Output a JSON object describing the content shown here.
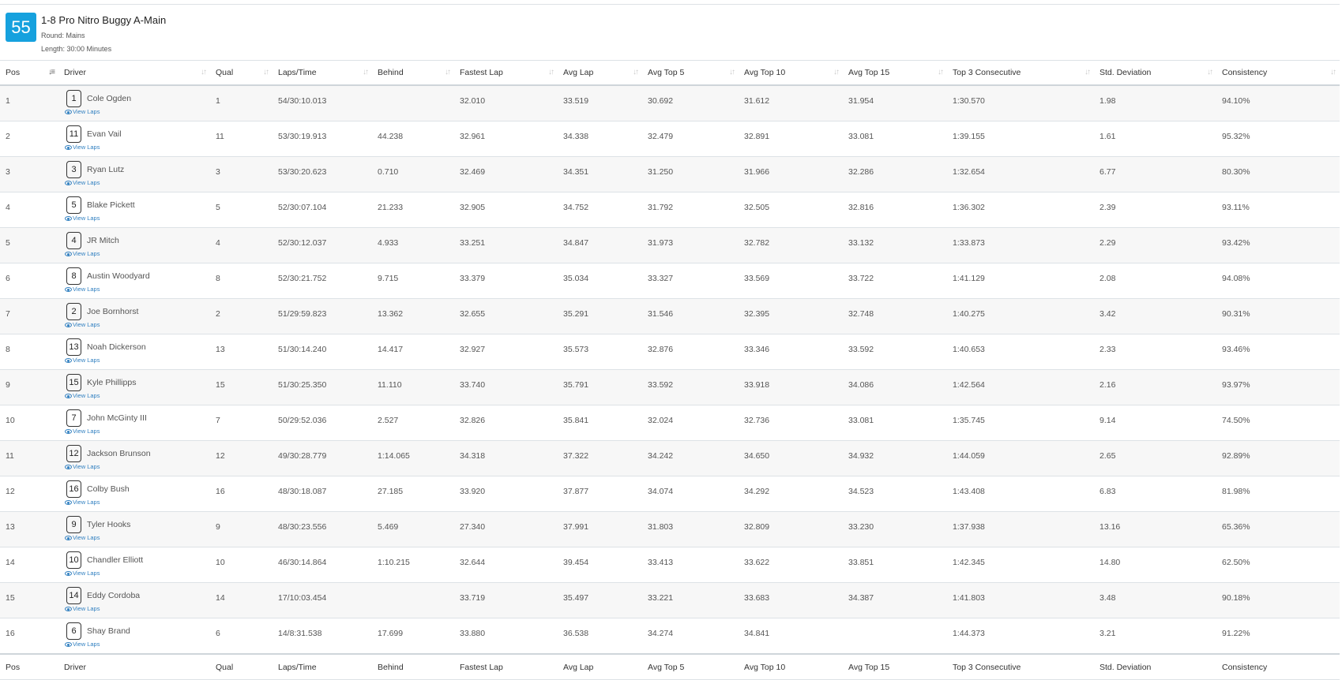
{
  "race": {
    "number": "55",
    "title": "1-8 Pro Nitro Buggy A-Main",
    "round": "Round: Mains",
    "length": "Length: 30:00 Minutes"
  },
  "columns": [
    "Pos",
    "Driver",
    "Qual",
    "Laps/Time",
    "Behind",
    "Fastest Lap",
    "Avg Lap",
    "Avg Top 5",
    "Avg Top 10",
    "Avg Top 15",
    "Top 3 Consecutive",
    "Std. Deviation",
    "Consistency"
  ],
  "view_laps_label": "View Laps",
  "rows": [
    {
      "pos": "1",
      "car": "1",
      "driver": "Cole Ogden",
      "qual": "1",
      "laps": "54/30:10.013",
      "behind": "",
      "fastest": "32.010",
      "avg": "33.519",
      "top5": "30.692",
      "top10": "31.612",
      "top15": "31.954",
      "top3c": "1:30.570",
      "std": "1.98",
      "cons": "94.10%"
    },
    {
      "pos": "2",
      "car": "11",
      "driver": "Evan Vail",
      "qual": "11",
      "laps": "53/30:19.913",
      "behind": "44.238",
      "fastest": "32.961",
      "avg": "34.338",
      "top5": "32.479",
      "top10": "32.891",
      "top15": "33.081",
      "top3c": "1:39.155",
      "std": "1.61",
      "cons": "95.32%"
    },
    {
      "pos": "3",
      "car": "3",
      "driver": "Ryan Lutz",
      "qual": "3",
      "laps": "53/30:20.623",
      "behind": "0.710",
      "fastest": "32.469",
      "avg": "34.351",
      "top5": "31.250",
      "top10": "31.966",
      "top15": "32.286",
      "top3c": "1:32.654",
      "std": "6.77",
      "cons": "80.30%"
    },
    {
      "pos": "4",
      "car": "5",
      "driver": "Blake Pickett",
      "qual": "5",
      "laps": "52/30:07.104",
      "behind": "21.233",
      "fastest": "32.905",
      "avg": "34.752",
      "top5": "31.792",
      "top10": "32.505",
      "top15": "32.816",
      "top3c": "1:36.302",
      "std": "2.39",
      "cons": "93.11%"
    },
    {
      "pos": "5",
      "car": "4",
      "driver": "JR Mitch",
      "qual": "4",
      "laps": "52/30:12.037",
      "behind": "4.933",
      "fastest": "33.251",
      "avg": "34.847",
      "top5": "31.973",
      "top10": "32.782",
      "top15": "33.132",
      "top3c": "1:33.873",
      "std": "2.29",
      "cons": "93.42%"
    },
    {
      "pos": "6",
      "car": "8",
      "driver": "Austin Woodyard",
      "qual": "8",
      "laps": "52/30:21.752",
      "behind": "9.715",
      "fastest": "33.379",
      "avg": "35.034",
      "top5": "33.327",
      "top10": "33.569",
      "top15": "33.722",
      "top3c": "1:41.129",
      "std": "2.08",
      "cons": "94.08%"
    },
    {
      "pos": "7",
      "car": "2",
      "driver": "Joe Bornhorst",
      "qual": "2",
      "laps": "51/29:59.823",
      "behind": "13.362",
      "fastest": "32.655",
      "avg": "35.291",
      "top5": "31.546",
      "top10": "32.395",
      "top15": "32.748",
      "top3c": "1:40.275",
      "std": "3.42",
      "cons": "90.31%"
    },
    {
      "pos": "8",
      "car": "13",
      "driver": "Noah Dickerson",
      "qual": "13",
      "laps": "51/30:14.240",
      "behind": "14.417",
      "fastest": "32.927",
      "avg": "35.573",
      "top5": "32.876",
      "top10": "33.346",
      "top15": "33.592",
      "top3c": "1:40.653",
      "std": "2.33",
      "cons": "93.46%"
    },
    {
      "pos": "9",
      "car": "15",
      "driver": "Kyle Phillipps",
      "qual": "15",
      "laps": "51/30:25.350",
      "behind": "11.110",
      "fastest": "33.740",
      "avg": "35.791",
      "top5": "33.592",
      "top10": "33.918",
      "top15": "34.086",
      "top3c": "1:42.564",
      "std": "2.16",
      "cons": "93.97%"
    },
    {
      "pos": "10",
      "car": "7",
      "driver": "John McGinty III",
      "qual": "7",
      "laps": "50/29:52.036",
      "behind": "2.527",
      "fastest": "32.826",
      "avg": "35.841",
      "top5": "32.024",
      "top10": "32.736",
      "top15": "33.081",
      "top3c": "1:35.745",
      "std": "9.14",
      "cons": "74.50%"
    },
    {
      "pos": "11",
      "car": "12",
      "driver": "Jackson Brunson",
      "qual": "12",
      "laps": "49/30:28.779",
      "behind": "1:14.065",
      "fastest": "34.318",
      "avg": "37.322",
      "top5": "34.242",
      "top10": "34.650",
      "top15": "34.932",
      "top3c": "1:44.059",
      "std": "2.65",
      "cons": "92.89%"
    },
    {
      "pos": "12",
      "car": "16",
      "driver": "Colby Bush",
      "qual": "16",
      "laps": "48/30:18.087",
      "behind": "27.185",
      "fastest": "33.920",
      "avg": "37.877",
      "top5": "34.074",
      "top10": "34.292",
      "top15": "34.523",
      "top3c": "1:43.408",
      "std": "6.83",
      "cons": "81.98%"
    },
    {
      "pos": "13",
      "car": "9",
      "driver": "Tyler Hooks",
      "qual": "9",
      "laps": "48/30:23.556",
      "behind": "5.469",
      "fastest": "27.340",
      "avg": "37.991",
      "top5": "31.803",
      "top10": "32.809",
      "top15": "33.230",
      "top3c": "1:37.938",
      "std": "13.16",
      "cons": "65.36%"
    },
    {
      "pos": "14",
      "car": "10",
      "driver": "Chandler Elliott",
      "qual": "10",
      "laps": "46/30:14.864",
      "behind": "1:10.215",
      "fastest": "32.644",
      "avg": "39.454",
      "top5": "33.413",
      "top10": "33.622",
      "top15": "33.851",
      "top3c": "1:42.345",
      "std": "14.80",
      "cons": "62.50%"
    },
    {
      "pos": "15",
      "car": "14",
      "driver": "Eddy Cordoba",
      "qual": "14",
      "laps": "17/10:03.454",
      "behind": "",
      "fastest": "33.719",
      "avg": "35.497",
      "top5": "33.221",
      "top10": "33.683",
      "top15": "34.387",
      "top3c": "1:41.803",
      "std": "3.48",
      "cons": "90.18%"
    },
    {
      "pos": "16",
      "car": "6",
      "driver": "Shay Brand",
      "qual": "6",
      "laps": "14/8:31.538",
      "behind": "17.699",
      "fastest": "33.880",
      "avg": "36.538",
      "top5": "34.274",
      "top10": "34.841",
      "top15": "",
      "top3c": "1:44.373",
      "std": "3.21",
      "cons": "91.22%"
    }
  ]
}
